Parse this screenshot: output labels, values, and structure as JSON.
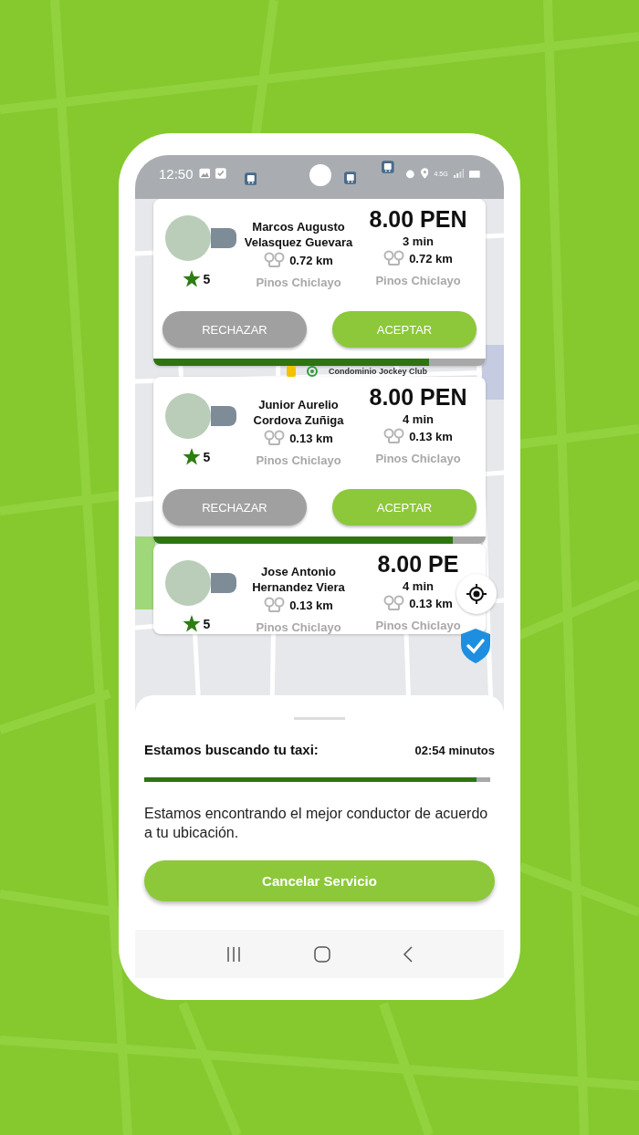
{
  "status_bar": {
    "time": "12:50",
    "network": "4.5G"
  },
  "map": {
    "place_label": "Condominio Jockey Club"
  },
  "offers": [
    {
      "driver_name": "Marcos Augusto Velasquez Guevara",
      "rating": "5",
      "driver_distance": "0.72 km",
      "driver_area": "Pinos Chiclayo",
      "price": "8.00 PEN",
      "eta": "3 min",
      "distance": "0.72 km",
      "area": "Pinos Chiclayo",
      "buttons": [
        "RECHAZAR",
        "ACEPTAR"
      ],
      "level": 0.83
    },
    {
      "driver_name": "Junior Aurelio Cordova Zuñiga",
      "rating": "5",
      "driver_distance": "0.13 km",
      "driver_area": "Pinos Chiclayo",
      "price": "8.00 PEN",
      "eta": "4 min",
      "distance": "0.13 km",
      "area": "Pinos Chiclayo",
      "buttons": [
        "RECHAZAR",
        "ACEPTAR"
      ],
      "level": 0.9
    },
    {
      "driver_name": "Jose Antonio Hernandez Viera",
      "rating": "5",
      "driver_distance": "0.13 km",
      "driver_area": "Pinos Chiclayo",
      "price": "8.00 PE",
      "eta": "4 min",
      "distance": "0.13 km",
      "area": "Pinos Chiclayo"
    }
  ],
  "search_sheet": {
    "title": "Estamos buscando tu taxi:",
    "timer": "02:54 minutos",
    "level": 0.96,
    "message": "Estamos encontrando el mejor conductor de acuerdo a tu ubicación.",
    "cancel_button": "Cancelar Servicio"
  }
}
